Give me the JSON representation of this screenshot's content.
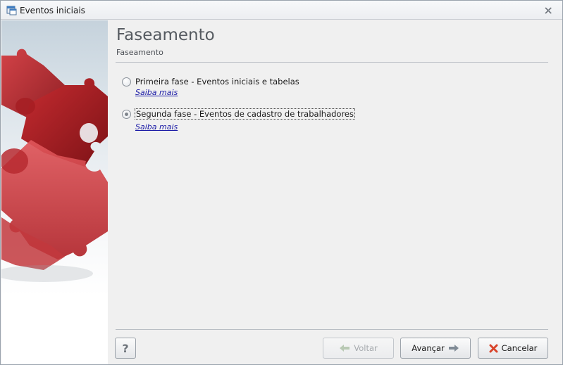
{
  "window": {
    "title": "Eventos iniciais",
    "icon": "app-window-icon",
    "close_icon": "close-icon"
  },
  "header": {
    "title": "Faseamento",
    "subtitle": "Faseamento"
  },
  "options": [
    {
      "label": "Primeira fase - Eventos iniciais e tabelas",
      "more": "Saiba mais",
      "checked": false
    },
    {
      "label": "Segunda fase - Eventos de cadastro de trabalhadores",
      "more": "Saiba mais",
      "checked": true
    }
  ],
  "footer": {
    "help_label": "?",
    "back_label": "Voltar",
    "next_label": "Avançar",
    "cancel_label": "Cancelar",
    "back_enabled": false
  },
  "colors": {
    "puzzle_red": "#b8252b",
    "puzzle_dark": "#8e1a1f",
    "link": "#1a1aa6",
    "cancel_icon": "#d8432a",
    "arrow_green": "#5a8f3a"
  }
}
